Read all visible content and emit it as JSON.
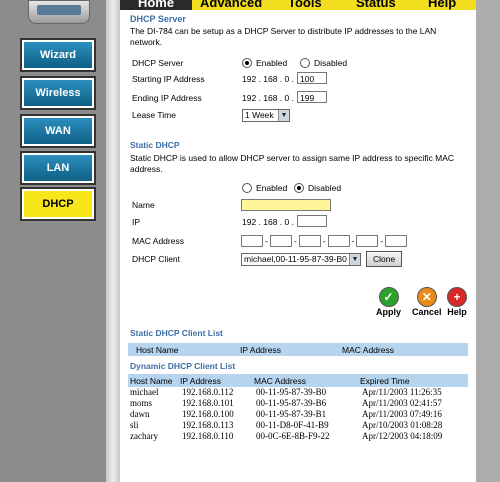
{
  "tabs": [
    "Home",
    "Advanced",
    "Tools",
    "Status",
    "Help"
  ],
  "sidebar": {
    "items": [
      {
        "label": "Wizard"
      },
      {
        "label": "Wireless"
      },
      {
        "label": "WAN"
      },
      {
        "label": "LAN"
      },
      {
        "label": "DHCP"
      }
    ]
  },
  "dhcp": {
    "title": "DHCP Server",
    "description": "The DI-784 can be setup as a DHCP Server to distribute IP addresses to the LAN network.",
    "server_label": "DHCP Server",
    "enabled_label": "Enabled",
    "disabled_label": "Disabled",
    "server_state": "Enabled",
    "start_label": "Starting IP Address",
    "start_prefix": "192 . 168 . 0 .",
    "start_value": "100",
    "end_label": "Ending IP Address",
    "end_prefix": "192 . 168 . 0 .",
    "end_value": "199",
    "lease_label": "Lease Time",
    "lease_value": "1 Week"
  },
  "static": {
    "title": "Static DHCP",
    "description": "Static DHCP is used to allow DHCP server to assign same IP address to specific MAC address.",
    "enabled_label": "Enabled",
    "disabled_label": "Disabled",
    "state": "Disabled",
    "name_label": "Name",
    "name_value": "",
    "ip_label": "IP",
    "ip_prefix": "192 . 168 . 0 .",
    "ip_value": "",
    "mac_label": "MAC Address",
    "mac_sep": "-",
    "client_label": "DHCP Client",
    "client_value": "michael,00-11-95-87-39-B0",
    "clone_label": "Clone"
  },
  "actions": {
    "apply": "Apply",
    "cancel": "Cancel",
    "help": "Help"
  },
  "static_list": {
    "title": "Static DHCP Client List",
    "headers": [
      "Host Name",
      "IP Address",
      "MAC Address"
    ]
  },
  "dynamic_list": {
    "title": "Dynamic DHCP Client List",
    "headers": [
      "Host Name",
      "IP Address",
      "MAC Address",
      "Expired Time"
    ],
    "rows": [
      [
        "michael",
        "192.168.0.112",
        "00-11-95-87-39-B0",
        "Apr/11/2003 11:26:35"
      ],
      [
        "moms",
        "192.168.0.101",
        "00-11-95-87-39-B6",
        "Apr/11/2003 02:41:57"
      ],
      [
        "dawn",
        "192.168.0.100",
        "00-11-95-87-39-B1",
        "Apr/11/2003 07:49:16"
      ],
      [
        "sli",
        "192.168.0.113",
        "00-11-D8-0F-41-B9",
        "Apr/10/2003 01:08:28"
      ],
      [
        "zachary",
        "192.168.0.110",
        "00-0C-6E-8B-F9-22",
        "Apr/12/2003 04:18:09"
      ]
    ]
  },
  "colors": {
    "accent_yellow": "#f2de1e",
    "nav_blue": "#1a76a3",
    "section_title": "#3d6ea6",
    "table_header": "#b7d4ee"
  }
}
